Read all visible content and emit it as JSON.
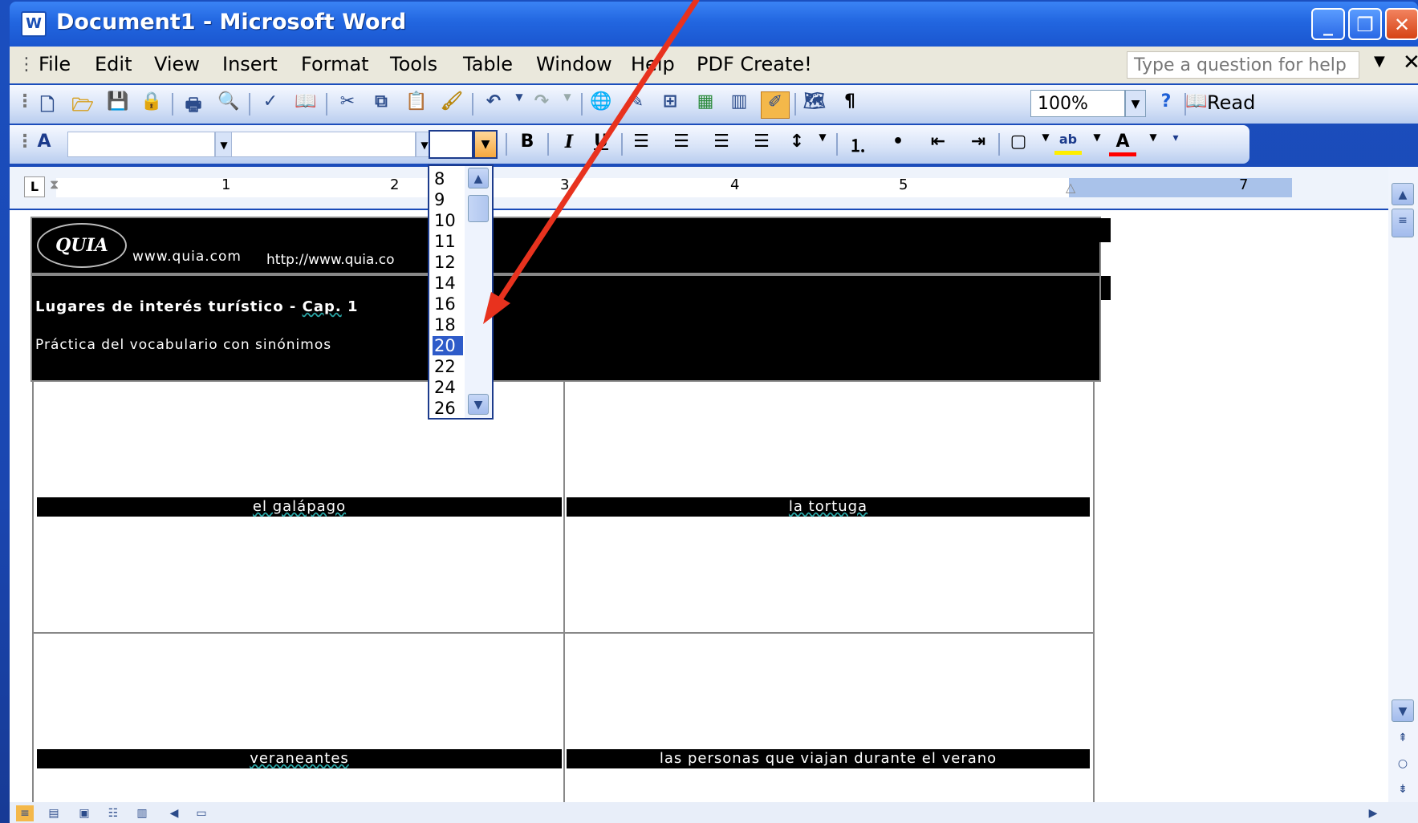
{
  "window": {
    "app_icon_letter": "W",
    "title": "Document1 - Microsoft Word",
    "minimize": "_",
    "restore": "❐",
    "close": "✕"
  },
  "menu": {
    "items": [
      "File",
      "Edit",
      "View",
      "Insert",
      "Format",
      "Tools",
      "Table",
      "Window",
      "Help",
      "PDF Create!"
    ],
    "help_placeholder": "Type a question for help",
    "close": "✕"
  },
  "toolbar": {
    "zoom": "100%",
    "read_label": "Read",
    "bold": "B",
    "italic": "I",
    "underline": "U",
    "font_color_glyph": "A",
    "highlight_glyph": "ab"
  },
  "font_size": {
    "current": "",
    "options": [
      "8",
      "9",
      "10",
      "11",
      "12",
      "14",
      "16",
      "18",
      "20",
      "22",
      "24",
      "26"
    ],
    "selected": "20"
  },
  "ruler": {
    "numbers": [
      "1",
      "2",
      "3",
      "4",
      "5",
      "7"
    ]
  },
  "document": {
    "quia_logo": "QUIA",
    "url_text": "www.quia.com",
    "url_full": "http://www.quia.co",
    "title_prefix": "Lugares de interés turístico - ",
    "title_cap": "Cap.",
    "title_suffix": " 1",
    "subtitle": "Práctica del vocabulario con sinónimos",
    "cards": [
      {
        "label": "el galápago"
      },
      {
        "label": "la tortuga"
      },
      {
        "label": "veraneantes"
      },
      {
        "label": "las personas que viajan durante el verano"
      }
    ]
  },
  "colors": {
    "annotation_arrow": "#e8321e",
    "selection": "#2e5bc9",
    "xp_title": "#2266e0"
  }
}
